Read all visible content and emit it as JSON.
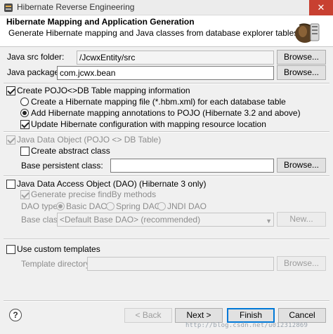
{
  "window": {
    "title": "Hibernate Reverse Engineering",
    "close_glyph": "✕"
  },
  "header": {
    "title": "Hibernate Mapping and Application Generation",
    "description": "Generate Hibernate mapping and Java classes from database explorer tables",
    "icon": "hibernate-bean-icon"
  },
  "java_src_folder": {
    "label": "Java src folder:",
    "value": "/JcwxEntity/src",
    "browse": "Browse..."
  },
  "java_package": {
    "label": "Java package:",
    "value": "com.jcwx.bean",
    "browse": "Browse..."
  },
  "pojo_mapping": {
    "label": "Create POJO<>DB Table mapping information",
    "checked": true,
    "options": [
      {
        "label": "Create a Hibernate mapping file (*.hbm.xml) for each database table",
        "selected": false
      },
      {
        "label": "Add Hibernate mapping annotations to POJO (Hibernate 3.2 and above)",
        "selected": true
      }
    ],
    "update_config": {
      "label": "Update Hibernate configuration with mapping resource location",
      "checked": true
    }
  },
  "java_data_object": {
    "label": "Java Data Object (POJO <> DB Table)",
    "checked": true,
    "abstract_class": {
      "label": "Create abstract class",
      "checked": false
    },
    "base_persistent_class": {
      "label": "Base persistent class:",
      "value": "",
      "browse": "Browse..."
    }
  },
  "dao": {
    "label": "Java Data Access Object (DAO) (Hibernate 3 only)",
    "checked": false,
    "findby": {
      "label": "Generate precise findBy methods",
      "checked": true
    },
    "dao_type_label": "DAO type:",
    "dao_types": [
      {
        "label": "Basic DAO",
        "selected": true
      },
      {
        "label": "Spring DAO",
        "selected": false
      },
      {
        "label": "JNDI DAO",
        "selected": false
      }
    ],
    "base_class_label": "Base class:",
    "base_class_value": "<Default Base DAO> (recommended)",
    "new_button": "New..."
  },
  "templates": {
    "label": "Use custom templates",
    "checked": false,
    "directory_label": "Template directory:",
    "directory_value": "",
    "browse": "Browse..."
  },
  "footer": {
    "help_glyph": "?",
    "back": "< Back",
    "next": "Next >",
    "finish": "Finish",
    "cancel": "Cancel"
  },
  "watermark": "http://blog.csdn.net/u012312869"
}
